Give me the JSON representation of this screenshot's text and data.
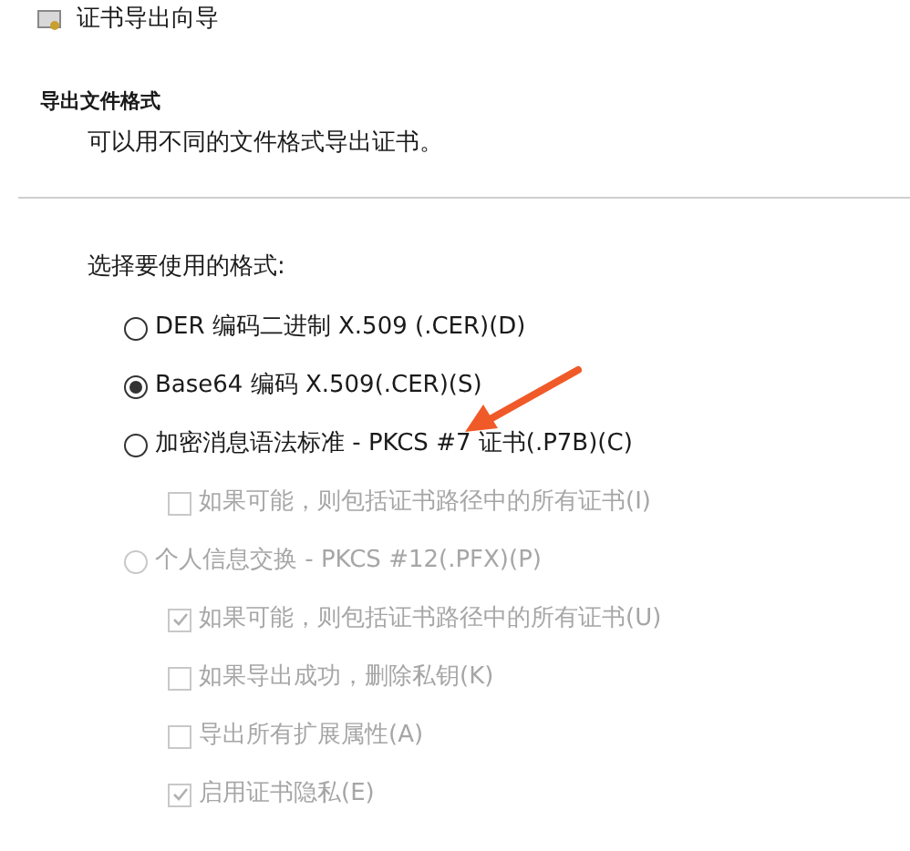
{
  "window": {
    "title": "证书导出向导"
  },
  "header": {
    "title": "导出文件格式",
    "subtitle": "可以用不同的文件格式导出证书。"
  },
  "prompt": "选择要使用的格式:",
  "options": [
    {
      "label": "DER 编码二进制 X.509 (.CER)(D)",
      "selected": false,
      "disabled": false
    },
    {
      "label": "Base64 编码 X.509(.CER)(S)",
      "selected": true,
      "disabled": false
    },
    {
      "label": "加密消息语法标准 - PKCS #7 证书(.P7B)(C)",
      "selected": false,
      "disabled": false,
      "children": [
        {
          "label": "如果可能，则包括证书路径中的所有证书(I)",
          "checked": false,
          "disabled": true
        }
      ]
    },
    {
      "label": "个人信息交换 - PKCS #12(.PFX)(P)",
      "selected": false,
      "disabled": true,
      "children": [
        {
          "label": "如果可能，则包括证书路径中的所有证书(U)",
          "checked": true,
          "disabled": true
        },
        {
          "label": "如果导出成功，删除私钥(K)",
          "checked": false,
          "disabled": true
        },
        {
          "label": "导出所有扩展属性(A)",
          "checked": false,
          "disabled": true
        },
        {
          "label": "启用证书隐私(E)",
          "checked": true,
          "disabled": true
        }
      ]
    }
  ]
}
